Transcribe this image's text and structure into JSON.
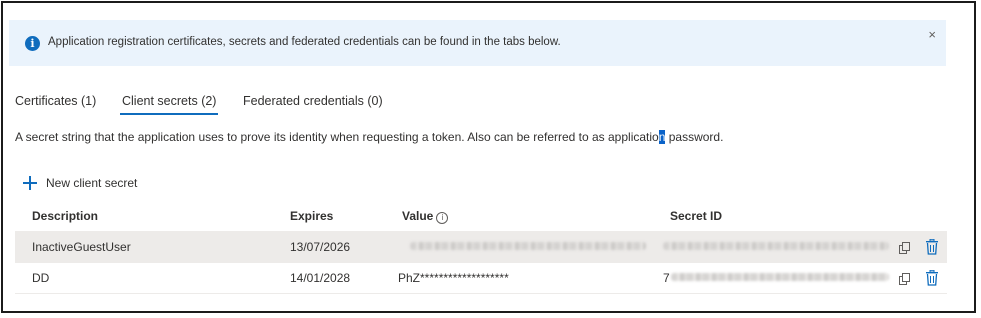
{
  "banner": {
    "icon": "info-icon",
    "text": "Application registration certificates, secrets and federated credentials can be found in the tabs below.",
    "close_label": "×",
    "background": "#eaf3fc",
    "icon_color": "#0f6cbd"
  },
  "tabs": [
    {
      "label": "Certificates (1)",
      "active": false
    },
    {
      "label": "Client secrets (2)",
      "active": true
    },
    {
      "label": "Federated credentials (0)",
      "active": false
    }
  ],
  "description": {
    "before": "A secret string that the application uses to prove its identity when requesting a token. Also can be referred to as applicatio",
    "highlight": "n",
    "after": " password."
  },
  "toolbar": {
    "new_secret_label": "New client secret",
    "accent": "#0f6cbd"
  },
  "table": {
    "columns": {
      "description": "Description",
      "expires": "Expires",
      "value": "Value",
      "value_info": "i",
      "secret_id": "Secret ID"
    },
    "rows": [
      {
        "description": "InactiveGuestUser",
        "expires": "13/07/2026",
        "value": "",
        "value_redacted": true,
        "secret_id_redacted": true,
        "selected": true
      },
      {
        "description": "DD",
        "expires": "14/01/2028",
        "value": "PhZ*******************",
        "value_redacted": false,
        "secret_id_prefix": "7",
        "secret_id_redacted": true,
        "selected": false
      }
    ]
  }
}
